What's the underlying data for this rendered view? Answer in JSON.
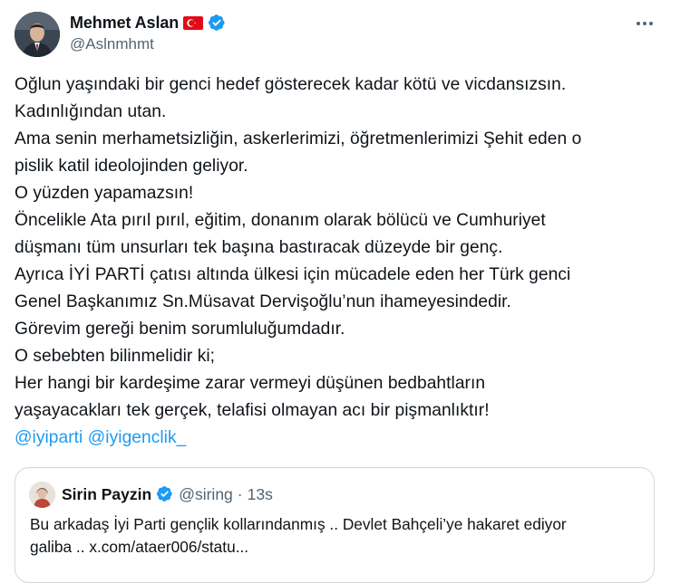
{
  "author": {
    "display_name": "Mehmet Aslan",
    "handle": "@Aslnmhmt",
    "flag": "turkey-flag-icon",
    "verified": true
  },
  "tweet": {
    "lines": [
      "Oğlun yaşındaki bir genci hedef gösterecek kadar kötü ve vicdansızsın.",
      "Kadınlığından utan.",
      "Ama senin merhametsizliğin, askerlerimizi, öğretmenlerimizi Şehit eden o",
      "pislik katil ideolojinden geliyor.",
      "O yüzden yapamazsın!",
      "Öncelikle Ata pırıl pırıl, eğitim, donanım olarak bölücü ve Cumhuriyet",
      "düşmanı tüm unsurları tek başına bastıracak düzeyde bir genç.",
      "Ayrıca İYİ PARTİ çatısı altında ülkesi için mücadele eden her Türk genci",
      "Genel Başkanımız Sn.Müsavat Dervişoğlu’nun ihameyesindedir.",
      "Görevim gereği benim sorumluluğumdadır.",
      "O sebebten bilinmelidir ki;",
      "Her hangi bir kardeşime zarar vermeyi düşünen bedbahtların",
      "yaşayacakları tek gerçek, telafisi olmayan acı bir pişmanlıktır!"
    ],
    "mentions": [
      "@iyiparti",
      "@iyigenclik_"
    ]
  },
  "quote": {
    "display_name": "Sirin Payzin",
    "handle": "@siring",
    "separator": "·",
    "time": "13s",
    "lines": [
      "Bu arkadaş İyi Parti  gençlik kollarındanmış .. Devlet Bahçeli’ye hakaret ediyor",
      "galiba .. x.com/ataer006/statu..."
    ]
  },
  "colors": {
    "text": "#0f1419",
    "secondary": "#536471",
    "link": "#1d9bf0",
    "verified": "#1d9bf0",
    "border": "#cfd9de",
    "flag_red": "#e30a17"
  },
  "icons": {
    "more": "more-horizontal-icon",
    "verified": "verified-badge-icon"
  }
}
